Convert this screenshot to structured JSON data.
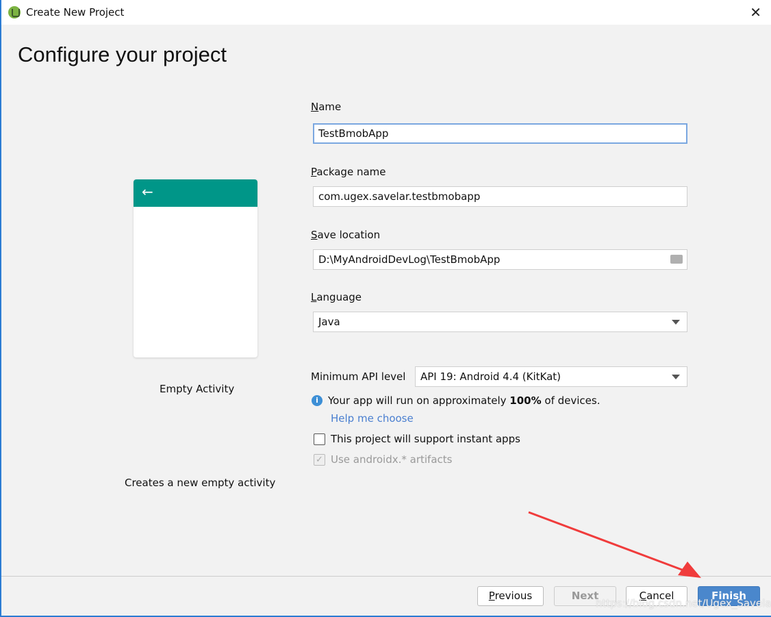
{
  "window": {
    "title": "Create New Project",
    "close": "✕"
  },
  "page": {
    "heading": "Configure your project"
  },
  "template": {
    "name": "Empty Activity",
    "description": "Creates a new empty activity",
    "back_arrow": "←",
    "accent": "#009688"
  },
  "form": {
    "name": {
      "label_u": "N",
      "label": "ame",
      "value": "TestBmobApp"
    },
    "package": {
      "label_u": "P",
      "label": "ackage name",
      "value": "com.ugex.savelar.testbmobapp"
    },
    "location": {
      "label_u": "S",
      "label": "ave location",
      "value": "D:\\MyAndroidDevLog\\TestBmobApp"
    },
    "language": {
      "label_u": "L",
      "label": "anguage",
      "value": "Java"
    },
    "min_api": {
      "label": "Minimum API level",
      "value": "API 19: Android 4.4 (KitKat)"
    },
    "info": {
      "pre": "Your app will run on approximately ",
      "bold": "100%",
      "post": " of devices.",
      "icon": "i"
    },
    "help_link": "Help me choose",
    "instant_apps": {
      "label": "This project will support instant apps",
      "checked": false
    },
    "androidx": {
      "label": "Use androidx.* artifacts",
      "checked": true,
      "disabled": true,
      "mark": "✓"
    }
  },
  "buttons": {
    "previous_u": "P",
    "previous": "revious",
    "next": "Next",
    "cancel_u": "C",
    "cancel": "ancel",
    "finish": "Finish"
  },
  "watermark": "https://blog.csdn.net/Ugex_Savelar",
  "annotation": {
    "arrow_color": "#f03c3c"
  }
}
